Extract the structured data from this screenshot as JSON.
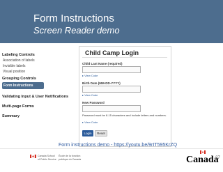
{
  "slide": {
    "title": "Form Instructions",
    "subtitle": "Screen Reader demo",
    "page_number": "27",
    "colors": {
      "header_bg": "#4d6d8e",
      "active_item_bg": "#4d6d8e",
      "link": "#2e5aa0"
    }
  },
  "sidebar": {
    "labeling_controls": "Labeling Controls",
    "labeling_items": [
      "Association of labels",
      "Invisible labels",
      "Visual position"
    ],
    "grouping_controls": "Grouping Controls",
    "active_item": "Form Instructions",
    "validating": "Validating Input & User Notifications",
    "multipage": "Multi-page Forms",
    "summary": "Summary"
  },
  "form": {
    "title": "Child Camp Login",
    "fields": [
      {
        "label": "Child Last Name (required)",
        "help": "▸ View Code"
      },
      {
        "label": "Birth Date (MM-DD-YYYY)",
        "help": "▸ View Code"
      },
      {
        "label": "New Password",
        "help": "▸ View Code"
      }
    ],
    "password_note": "Password must be 8-15 characters and include letters and numbers.",
    "submit_label": "Login",
    "reset_label": "Reset"
  },
  "footer": {
    "demo_link": "Form instructions demo - https://youtu.be/9rIT595KrZQ",
    "gov_en": [
      "Canada School",
      "of Public Service"
    ],
    "gov_fr": [
      "École de la fonction",
      "publique du Canada"
    ],
    "wordmark": "Canada"
  }
}
